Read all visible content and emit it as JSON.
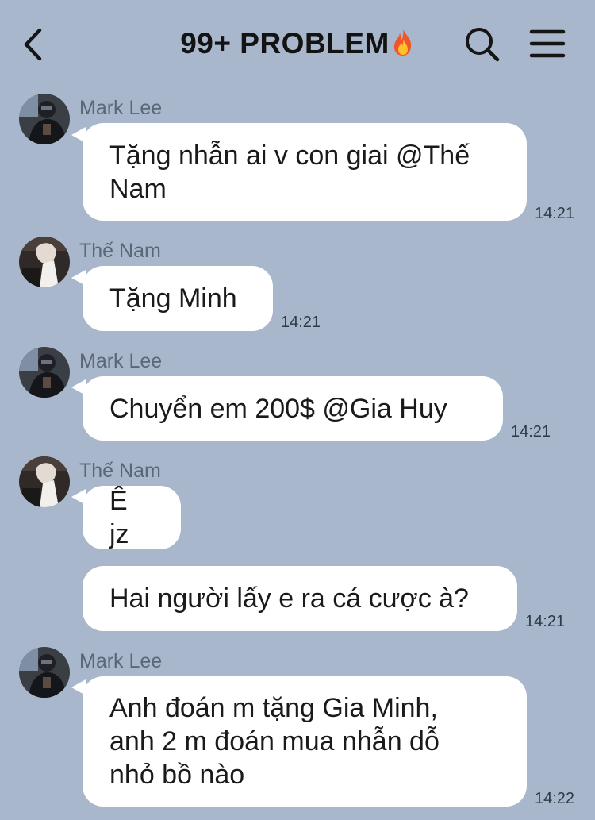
{
  "header": {
    "back_icon": "chevron-left-icon",
    "title": "99+ PROBLEM",
    "title_emoji": "fire-emoji",
    "search_icon": "search-icon",
    "menu_icon": "hamburger-menu-icon"
  },
  "colors": {
    "background": "#a8b7cb",
    "bubble": "#ffffff",
    "sender_name": "#5b6777",
    "timestamp": "#2f3947",
    "title": "#131313"
  },
  "messages": [
    {
      "sender": "Mark Lee",
      "lines": [
        "Tặng nhẫn ai v con giai @Thế",
        "Nam"
      ],
      "time": "14:21"
    },
    {
      "sender": "Thế Nam",
      "lines": [
        "Tặng Minh"
      ],
      "time": "14:21"
    },
    {
      "sender": "Mark Lee",
      "lines": [
        "Chuyển em 200$ @Gia Huy"
      ],
      "time": "14:21"
    },
    {
      "sender": "Thế Nam",
      "lines": [
        "Ê jz"
      ],
      "time": ""
    },
    {
      "sender": "",
      "lines": [
        "Hai người lấy e ra cá cược à?"
      ],
      "time": "14:21"
    },
    {
      "sender": "Mark Lee",
      "lines": [
        "Anh đoán m tặng Gia Minh,",
        "anh 2 m đoán mua nhẫn dỗ",
        "nhỏ bồ nào"
      ],
      "time": "14:22"
    }
  ]
}
